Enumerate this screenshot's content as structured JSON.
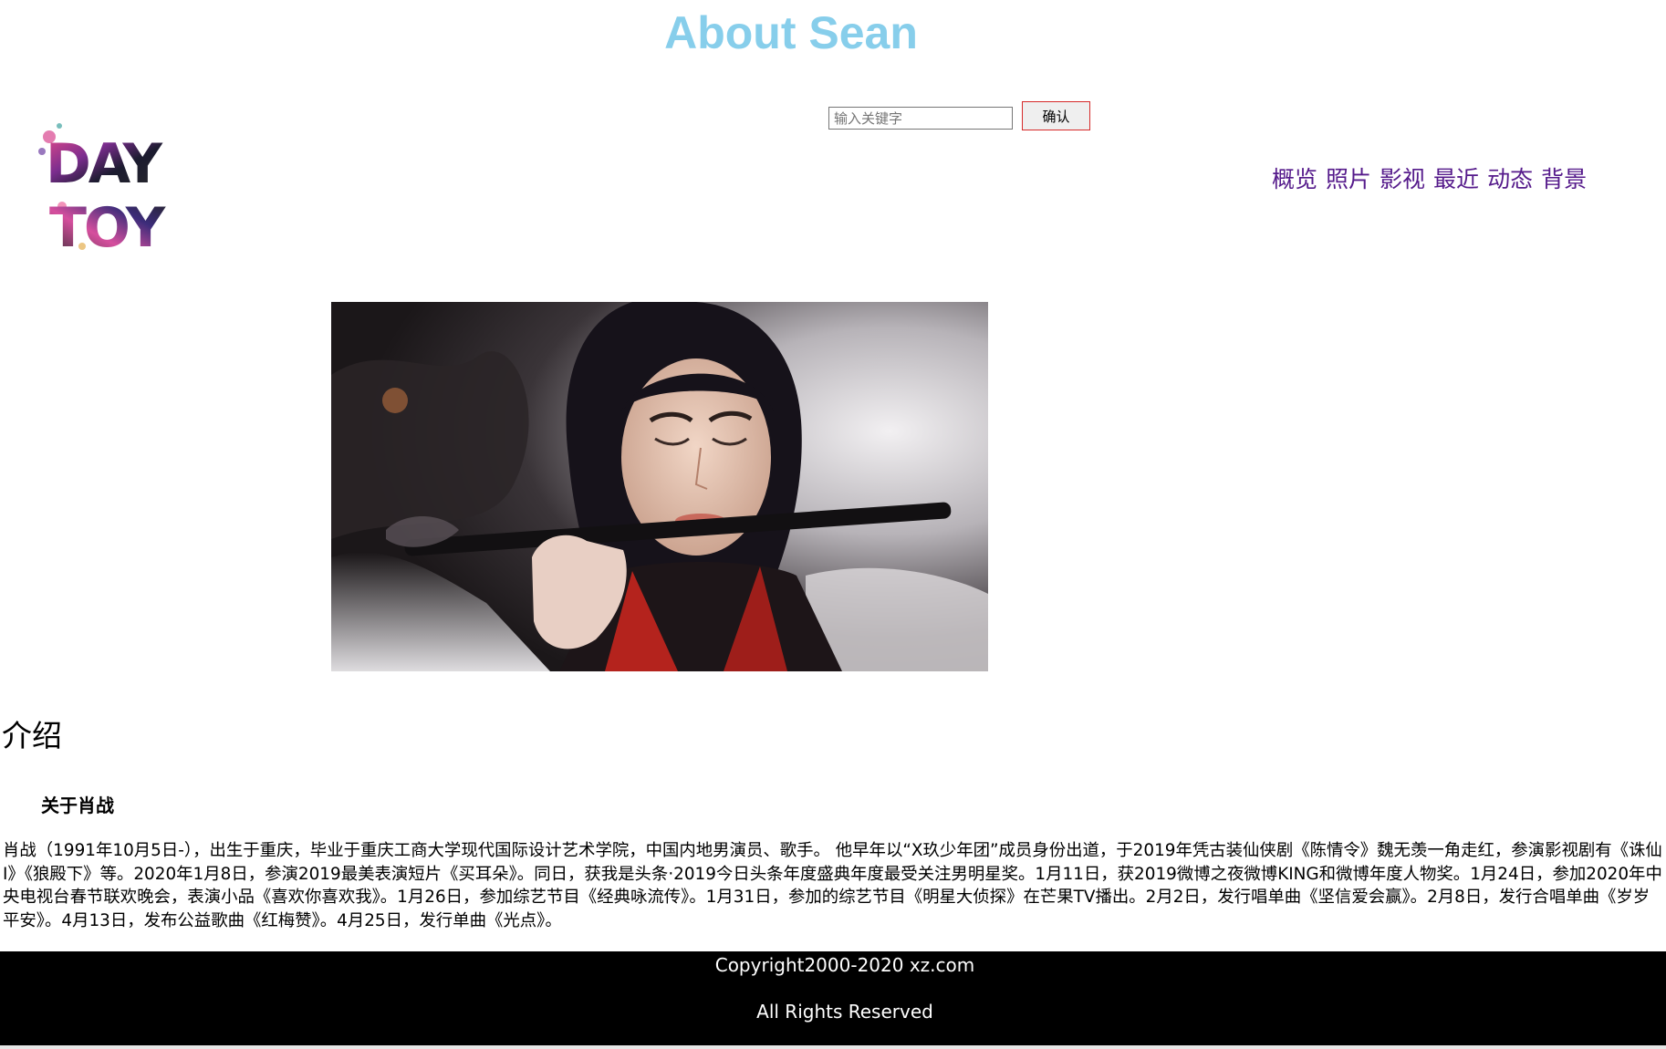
{
  "header": {
    "title": "About Sean"
  },
  "search": {
    "placeholder": "输入关键字",
    "value": "",
    "button_label": "确认"
  },
  "logo": {
    "line1": "DAY",
    "line2": "TOY"
  },
  "nav": {
    "items": [
      {
        "label": "概览"
      },
      {
        "label": "照片"
      },
      {
        "label": "影视"
      },
      {
        "label": "最近"
      },
      {
        "label": "动态"
      },
      {
        "label": "背景"
      }
    ]
  },
  "intro": {
    "heading": "介绍",
    "subheading": "关于肖战",
    "body": "肖战（1991年10月5日-），出生于重庆，毕业于重庆工商大学现代国际设计艺术学院，中国内地男演员、歌手。 他早年以“X玖少年团”成员身份出道，于2019年凭古装仙侠剧《陈情令》魏无羡一角走红，参演影视剧有《诛仙Ⅰ》《狼殿下》等。2020年1月8日，参演2019最美表演短片《买耳朵》。同日，获我是头条·2019今日头条年度盛典年度最受关注男明星奖。1月11日，获2019微博之夜微博KING和微博年度人物奖。1月24日，参加2020年中央电视台春节联欢晚会，表演小品《喜欢你喜欢我》。1月26日，参加综艺节目《经典咏流传》。1月31日，参加的综艺节目《明星大侦探》在芒果TV播出。2月2日，发行唱单曲《坚信爱会赢》。2月8日，发行合唱单曲《岁岁平安》。4月13日，发布公益歌曲《红梅赞》。4月25日，发行单曲《光点》。"
  },
  "footer": {
    "copyright": "Copyright2000-2020  xz.com",
    "rights": "All Rights Reserved"
  },
  "colors": {
    "title": "#87ceeb",
    "nav_link": "#551a8b",
    "footer_bg": "#000000",
    "footer_text": "#ffffff",
    "button_border": "#d62a2a"
  }
}
